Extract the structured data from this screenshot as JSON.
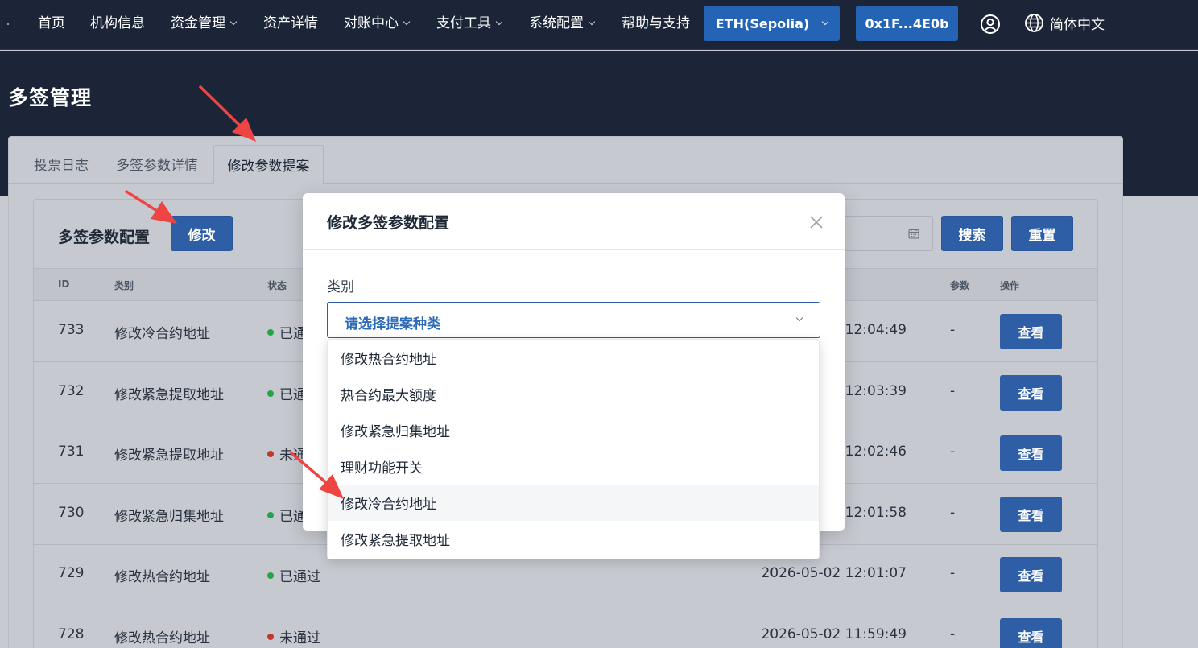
{
  "topnav": {
    "items": [
      {
        "label": "首页",
        "dropdown": false
      },
      {
        "label": "机构信息",
        "dropdown": false
      },
      {
        "label": "资金管理",
        "dropdown": true
      },
      {
        "label": "资产详情",
        "dropdown": false
      },
      {
        "label": "对账中心",
        "dropdown": true
      },
      {
        "label": "支付工具",
        "dropdown": true
      },
      {
        "label": "系统配置",
        "dropdown": true
      },
      {
        "label": "帮助与支持",
        "dropdown": false
      }
    ],
    "network": "ETH(Sepolia)",
    "wallet": "0x1F...4E0b",
    "language": "简体中文"
  },
  "page": {
    "title": "多签管理",
    "tabs": [
      "投票日志",
      "多签参数详情",
      "修改参数提案"
    ],
    "active_tab": "修改参数提案"
  },
  "section": {
    "title": "多签参数配置",
    "modify_button": "修改",
    "search_button": "搜索",
    "reset_button": "重置"
  },
  "table": {
    "headers": {
      "id": "ID",
      "category": "类别",
      "status": "状态",
      "params": "参数",
      "actions": "操作"
    },
    "rows": [
      {
        "id": "733",
        "category": "修改冷合约地址",
        "status": "已通",
        "status_type": "passed",
        "time": "12:04:49",
        "param": "-",
        "action": "查看"
      },
      {
        "id": "732",
        "category": "修改紧急提取地址",
        "status": "已通",
        "status_type": "passed",
        "time": "12:03:39",
        "param": "-",
        "action": "查看"
      },
      {
        "id": "731",
        "category": "修改紧急提取地址",
        "status": "未通",
        "status_type": "failed",
        "time": "12:02:46",
        "param": "-",
        "action": "查看"
      },
      {
        "id": "730",
        "category": "修改紧急归集地址",
        "status": "已通",
        "status_type": "passed",
        "time": "12:01:58",
        "param": "-",
        "action": "查看"
      },
      {
        "id": "729",
        "category": "修改热合约地址",
        "status": "已通过",
        "status_type": "passed",
        "time": "2026-05-02 12:01:07",
        "param": "-",
        "action": "查看"
      },
      {
        "id": "728",
        "category": "修改热合约地址",
        "status": "未通过",
        "status_type": "failed",
        "time": "2026-05-02 11:59:49",
        "param": "-",
        "action": "查看"
      }
    ]
  },
  "modal": {
    "title": "修改多签参数配置",
    "field_label": "类别",
    "select_placeholder": "请选择提案种类",
    "options": [
      "修改热合约地址",
      "热合约最大额度",
      "修改紧急归集地址",
      "理财功能开关",
      "修改冷合约地址",
      "修改紧急提取地址"
    ],
    "hovered_option": "修改冷合约地址"
  },
  "colors": {
    "nav_bg": "#1b2537",
    "primary": "#2d5ea6",
    "status_passed": "#22a447",
    "status_failed": "#c0392b",
    "annotation_arrow": "#ef4444"
  }
}
